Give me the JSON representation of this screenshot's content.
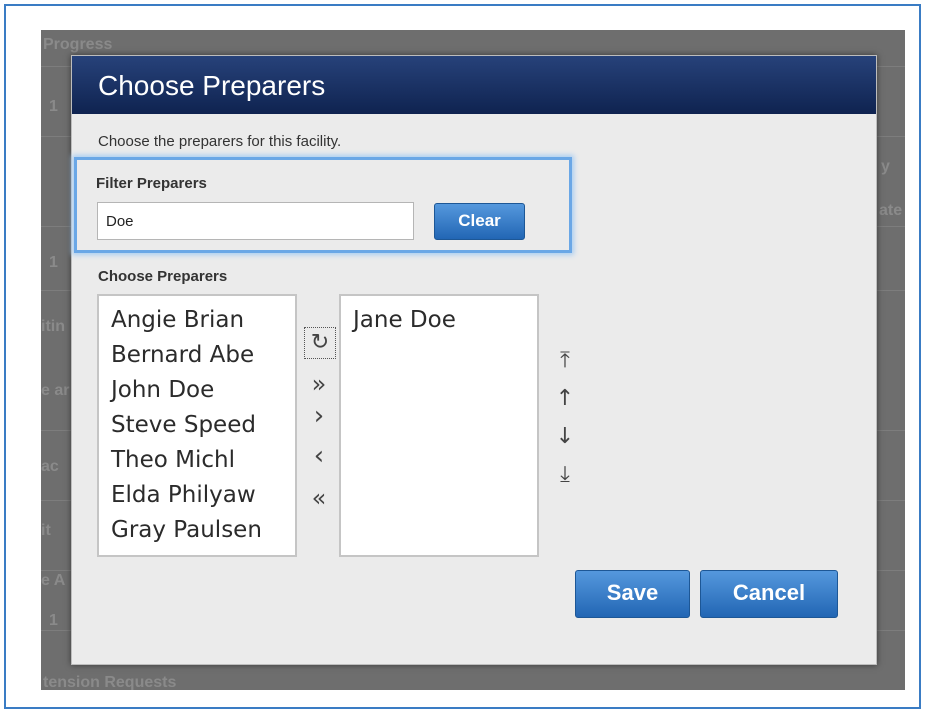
{
  "background": {
    "section_progress": "Progress",
    "section_extension": "tension Requests",
    "side_fragments": [
      "y",
      "ate",
      "itin",
      "e ar",
      "ac",
      "it",
      "e A",
      "1",
      "1",
      "1"
    ]
  },
  "dialog": {
    "title": "Choose Preparers",
    "intro": "Choose the preparers for this facility.",
    "filter": {
      "label": "Filter Preparers",
      "value": "Doe",
      "clear_label": "Clear"
    },
    "choose_label": "Choose Preparers",
    "available": [
      "Angie Brian",
      "Bernard Abe",
      "John Doe",
      "Steve Speed",
      "Theo Michl",
      "Elda Philyaw",
      "Gray Paulsen"
    ],
    "selected": [
      "Jane Doe"
    ],
    "transfer_controls": {
      "refresh": "↻",
      "move_all_right": "»",
      "move_right": "›",
      "move_left": "‹",
      "move_all_left": "«"
    },
    "order_controls": {
      "move_top": "⤒",
      "move_up": "↑",
      "move_down": "↓",
      "move_bottom": "⤓"
    },
    "save_label": "Save",
    "cancel_label": "Cancel"
  },
  "colors": {
    "header": "#0f2350",
    "button": "#2266b4",
    "filter_highlight": "#6aa7e6"
  }
}
